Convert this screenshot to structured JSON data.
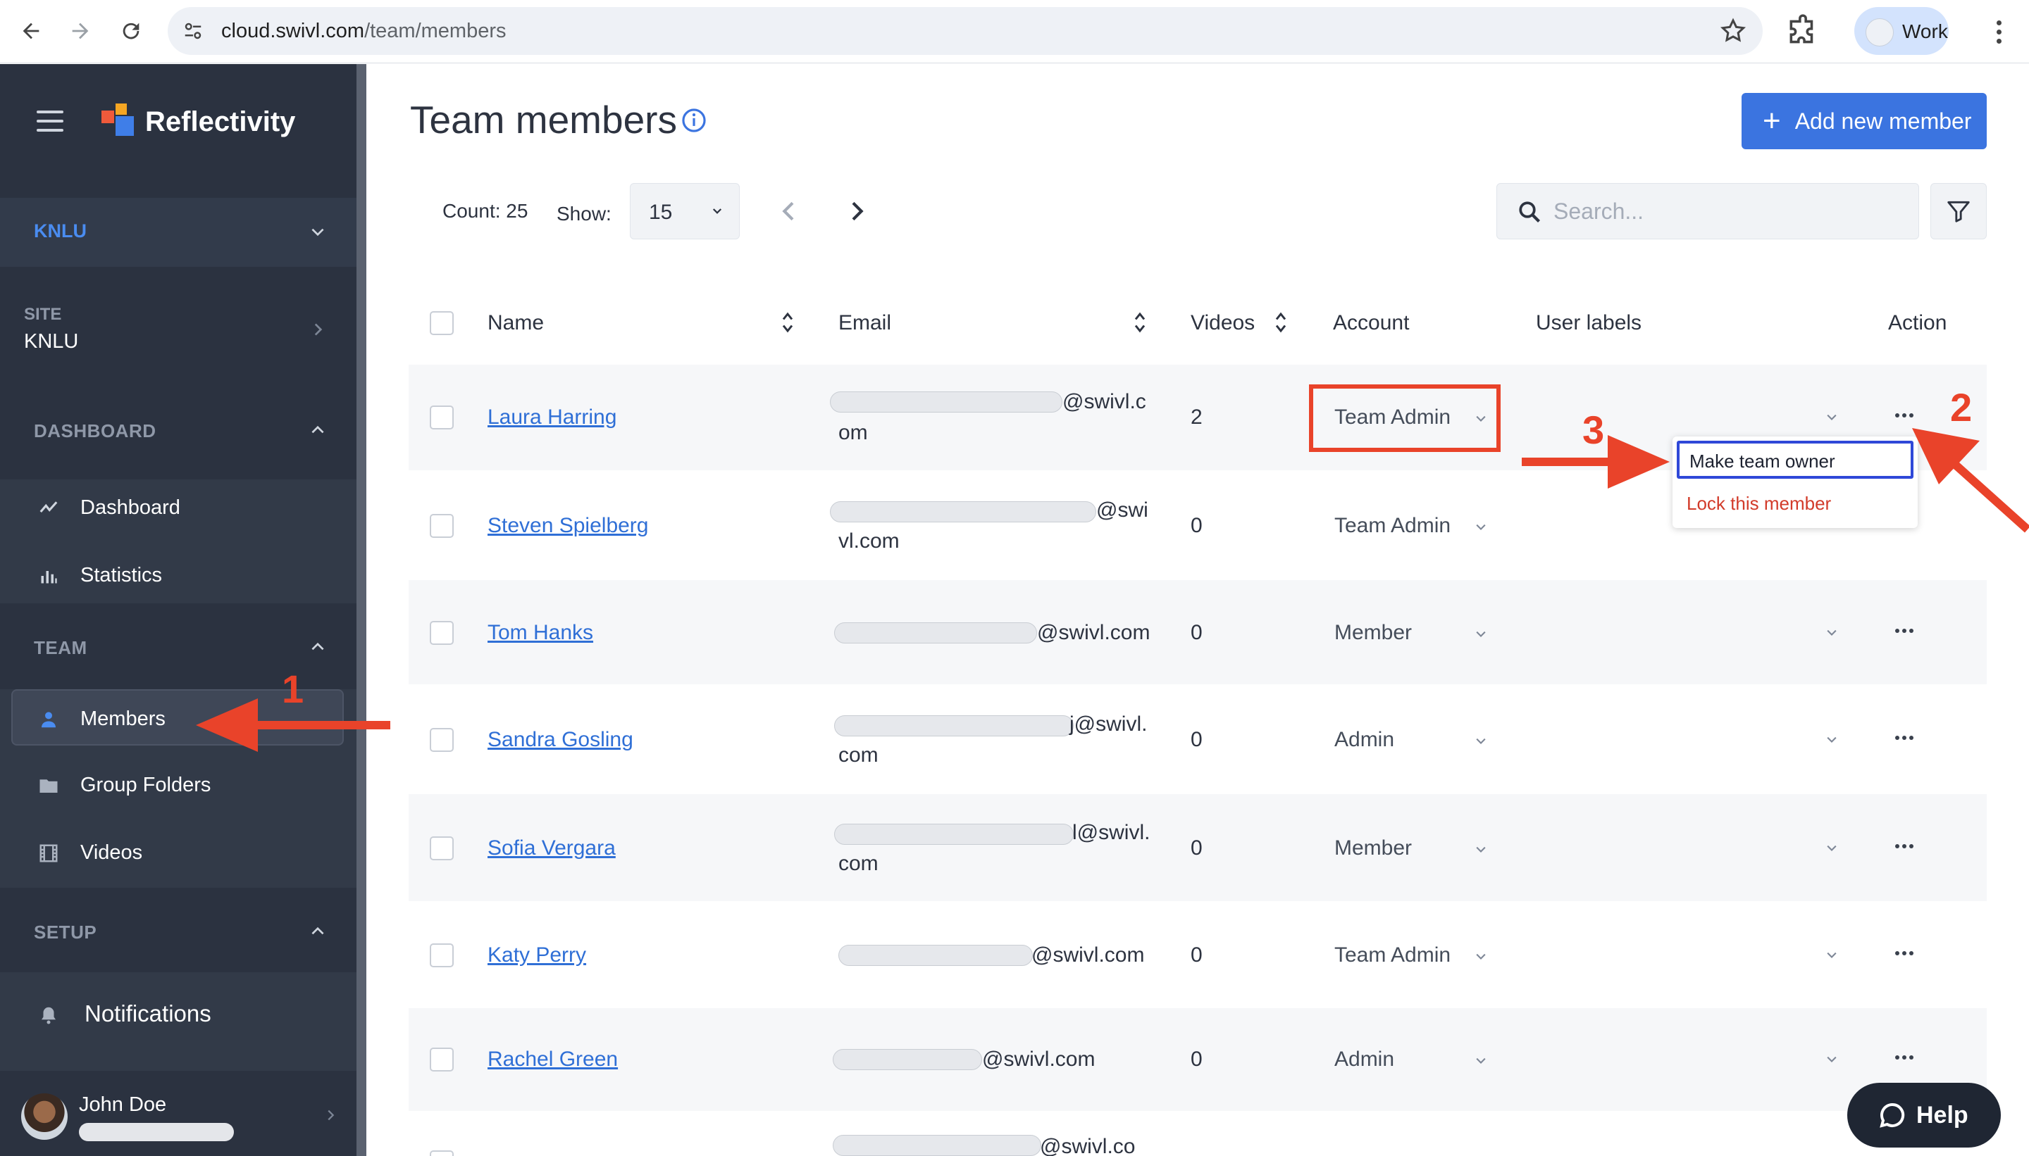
{
  "browser": {
    "url_host": "cloud.swivl.com",
    "url_path": "/team/members",
    "profile_label": "Work"
  },
  "sidebar": {
    "brand": "Reflectivity",
    "team_selector": "KNLU",
    "site_label": "SITE",
    "site_value": "KNLU",
    "groups": {
      "dashboard": "DASHBOARD",
      "team": "TEAM",
      "setup": "SETUP"
    },
    "items": {
      "dashboard": "Dashboard",
      "statistics": "Statistics",
      "members": "Members",
      "group_folders": "Group Folders",
      "videos": "Videos",
      "notifications": "Notifications"
    },
    "user_name": "John Doe"
  },
  "main": {
    "title": "Team members",
    "add_button": "Add new member",
    "count_text": "Count: 25",
    "show_label": "Show:",
    "show_value": "15",
    "search_placeholder": "Search...",
    "columns": {
      "name": "Name",
      "email": "Email",
      "videos": "Videos",
      "account": "Account",
      "user_labels": "User labels",
      "action": "Action"
    },
    "rows": [
      {
        "name": "Laura Harring",
        "email_line1": "@swivl.c",
        "email_line2": "om",
        "videos": "2",
        "account": "Team Admin"
      },
      {
        "name": "Steven Spielberg",
        "email_line1": "@swi",
        "email_line2": "vl.com",
        "videos": "0",
        "account": "Team Admin"
      },
      {
        "name": "Tom Hanks",
        "email_line1": "@swivl.com",
        "email_line2": "",
        "videos": "0",
        "account": "Member"
      },
      {
        "name": "Sandra Gosling",
        "email_line1": "j@swivl.",
        "email_line2": "com",
        "videos": "0",
        "account": "Admin"
      },
      {
        "name": "Sofia Vergara",
        "email_line1": "l@swivl.",
        "email_line2": "com",
        "videos": "0",
        "account": "Member"
      },
      {
        "name": "Katy Perry",
        "email_line1": "@swivl.com",
        "email_line2": "",
        "videos": "0",
        "account": "Team Admin"
      },
      {
        "name": "Rachel Green",
        "email_line1": "@swivl.com",
        "email_line2": "",
        "videos": "0",
        "account": "Admin"
      },
      {
        "name": "",
        "email_line1": "@swivl.co",
        "email_line2": "",
        "videos": "",
        "account": ""
      }
    ],
    "action_menu": {
      "option1": "Make team owner",
      "option2": "Lock this member"
    }
  },
  "annotations": {
    "step1": "1",
    "step2": "2",
    "step3": "3",
    "color": "#e9432a"
  },
  "help_button": "Help",
  "colors": {
    "sidebar_bg": "#2b3240",
    "accent_blue": "#3b74e0",
    "link_blue": "#2f6fd6",
    "danger_red": "#d23b2a"
  }
}
